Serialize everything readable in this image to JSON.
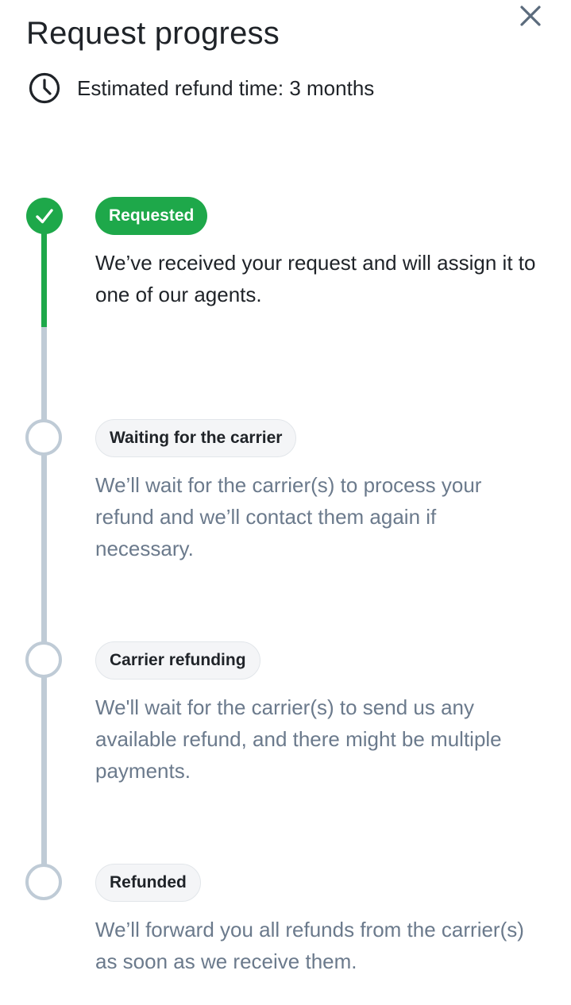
{
  "header": {
    "title": "Request progress",
    "close_icon": "close-icon"
  },
  "estimate": {
    "icon": "clock-icon",
    "text": "Estimated refund time: 3 months"
  },
  "colors": {
    "complete": "#1ea84a",
    "pending_line": "#bfcbd6",
    "pending_text": "#6b7a8c",
    "pending_pill_bg": "#f4f5f7"
  },
  "steps": [
    {
      "label": "Requested",
      "status": "complete",
      "icon": "check-icon",
      "description": "We’ve received your request and will assign it to one of our agents."
    },
    {
      "label": "Waiting for the carrier",
      "status": "pending",
      "description": "We’ll wait for the carrier(s) to process your refund and we’ll contact them again if necessary."
    },
    {
      "label": "Carrier refunding",
      "status": "pending",
      "description": "We'll wait for the carrier(s) to send us any available refund, and there might be multiple payments."
    },
    {
      "label": "Refunded",
      "status": "pending",
      "description": "We’ll forward you all refunds from the carrier(s) as soon as we receive them."
    }
  ]
}
